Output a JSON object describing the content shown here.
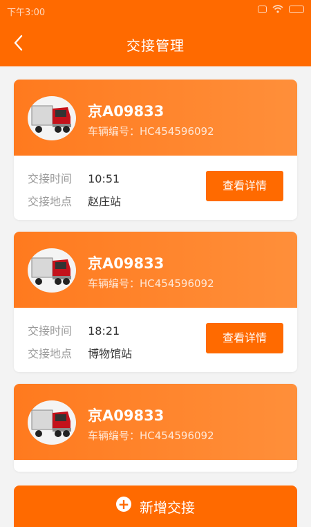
{
  "status_bar": {
    "time": "下午3:00"
  },
  "nav": {
    "title": "交接管理"
  },
  "cards": [
    {
      "plate": "京A09833",
      "vehicle_id": "车辆编号：HC454596092",
      "time_label": "交接时间",
      "time": "10:51",
      "place_label": "交接地点",
      "place": "赵庄站",
      "button": "查看详情"
    },
    {
      "plate": "京A09833",
      "vehicle_id": "车辆编号：HC454596092",
      "time_label": "交接时间",
      "time": "18:21",
      "place_label": "交接地点",
      "place": "博物馆站",
      "button": "查看详情"
    },
    {
      "plate": "京A09833",
      "vehicle_id": "车辆编号：HC454596092"
    }
  ],
  "add_button": {
    "label": "新增交接"
  },
  "colors": {
    "primary": "#ff6a00",
    "card_head": "#ff8a30"
  }
}
